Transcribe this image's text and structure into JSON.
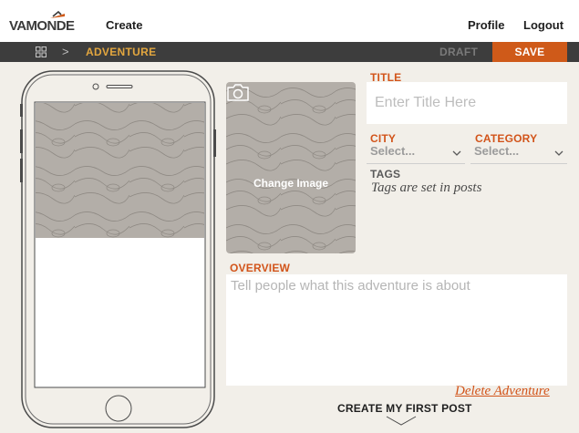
{
  "brand": {
    "logo_text": "VAMONDE",
    "accent": "#cf5a19",
    "crumb_color": "#e2a63f"
  },
  "nav": {
    "create": "Create",
    "profile": "Profile",
    "logout": "Logout"
  },
  "subnav": {
    "separator": ">",
    "breadcrumb": "ADVENTURE",
    "draft": "DRAFT",
    "save": "SAVE",
    "grid_icon": "grid-icon"
  },
  "cover": {
    "change_image": "Change Image",
    "icon": "camera-icon"
  },
  "form": {
    "title_label": "TITLE",
    "title_placeholder": "Enter Title Here",
    "title_value": "",
    "city_label": "CITY",
    "city_value": "Select...",
    "category_label": "CATEGORY",
    "category_value": "Select...",
    "tags_label": "TAGS",
    "tags_value": "Tags are set in posts",
    "overview_label": "OVERVIEW",
    "overview_placeholder": "Tell people what this adventure is about",
    "overview_value": ""
  },
  "actions": {
    "delete": "Delete Adventure",
    "create_first_post": "CREATE MY FIRST POST"
  }
}
